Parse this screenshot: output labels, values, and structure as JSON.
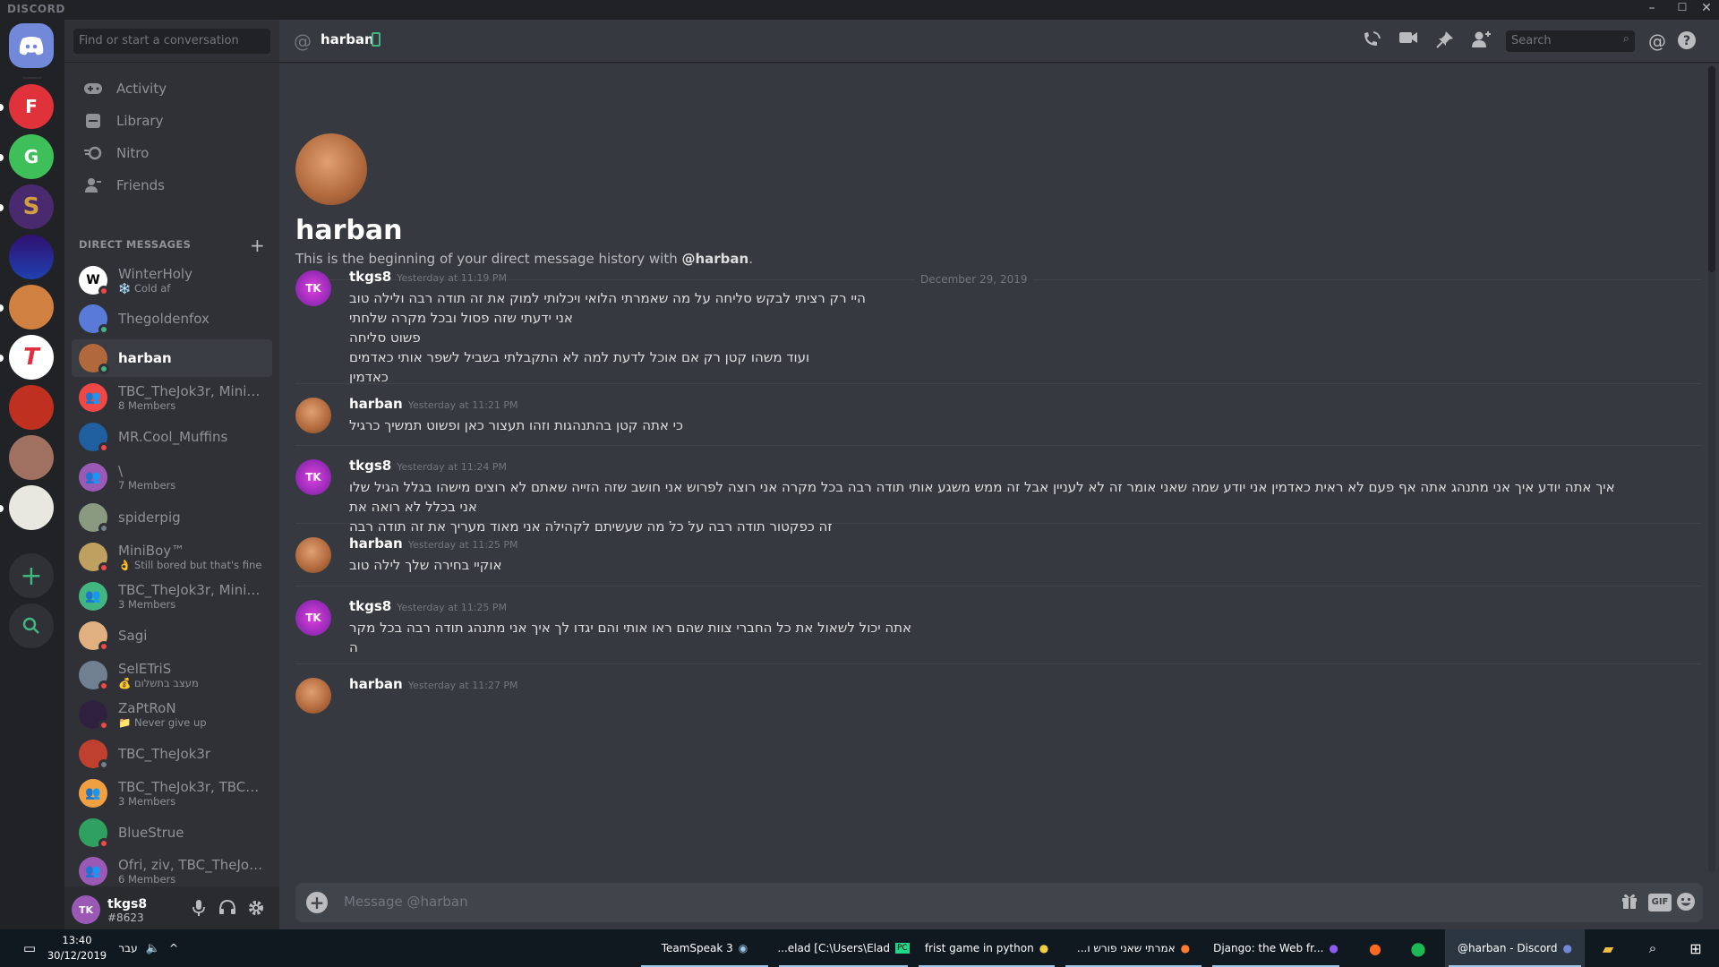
{
  "window": {
    "brand": "DISCORD",
    "controls": [
      "–",
      "☐",
      "✕"
    ]
  },
  "guilds": [
    {
      "name": "Home",
      "initial": "",
      "color": "#7289da"
    },
    {
      "name": "server-fedix",
      "initial": "F",
      "color": "#e0323a"
    },
    {
      "name": "server-green",
      "initial": "G",
      "color": "#3fbf5a"
    },
    {
      "name": "server-s",
      "initial": "S",
      "color": "#4a2a6e"
    },
    {
      "name": "server-blue",
      "initial": "",
      "color": "#2040b0"
    },
    {
      "name": "server-face",
      "initial": "",
      "color": "#d08040"
    },
    {
      "name": "server-t",
      "initial": "T",
      "color": "#e03040"
    },
    {
      "name": "server-red",
      "initial": "",
      "color": "#c03020"
    },
    {
      "name": "server-man",
      "initial": "",
      "color": "#a07060"
    },
    {
      "name": "server-dino",
      "initial": "",
      "color": "#e0e0e0"
    }
  ],
  "sidebar": {
    "search_placeholder": "Find or start a conversation",
    "nav": [
      {
        "label": "Activity",
        "icon": "activity-icon"
      },
      {
        "label": "Library",
        "icon": "library-icon"
      },
      {
        "label": "Nitro",
        "icon": "nitro-icon"
      },
      {
        "label": "Friends",
        "icon": "friends-icon"
      }
    ],
    "dm_header": "DIRECT MESSAGES",
    "dms": [
      {
        "name": "WinterHoly",
        "sub": "❄️ Cold af",
        "avatar_letter": "W",
        "color": "#ffffff",
        "status": "#f04747"
      },
      {
        "name": "Thegoldenfox",
        "sub": "",
        "avatar_letter": "",
        "color": "#5a7ad8",
        "status": "#43b581"
      },
      {
        "name": "harban",
        "sub": "",
        "avatar_letter": "",
        "color": "#b0683c",
        "status": "#43b581"
      },
      {
        "name": "TBC_TheJok3r, MiniB...",
        "sub": "8 Members",
        "avatar_letter": "👥",
        "color": "#f04747",
        "status": ""
      },
      {
        "name": "MR.Cool_Muffins",
        "sub": "",
        "avatar_letter": "",
        "color": "#2060a0",
        "status": "#f04747"
      },
      {
        "name": "\\",
        "sub": "7 Members",
        "avatar_letter": "👥",
        "color": "#9b59b6",
        "status": ""
      },
      {
        "name": "spiderpig",
        "sub": "",
        "avatar_letter": "",
        "color": "#8a9a80",
        "status": "#747f8d"
      },
      {
        "name": "MiniBoy™",
        "sub": "👌 Still bored but that's fine",
        "avatar_letter": "",
        "color": "#c0a060",
        "status": "#f04747"
      },
      {
        "name": "TBC_TheJok3r, MiniB...",
        "sub": "3 Members",
        "avatar_letter": "👥",
        "color": "#43b581",
        "status": ""
      },
      {
        "name": "Sagi",
        "sub": "",
        "avatar_letter": "",
        "color": "#e0b080",
        "status": "#f04747"
      },
      {
        "name": "SelETriS",
        "sub": "💰 מעצב בתשלום",
        "avatar_letter": "",
        "color": "#708090",
        "status": "#f04747"
      },
      {
        "name": "ZaPtRoN",
        "sub": "📁 Never give up",
        "avatar_letter": "",
        "color": "#302040",
        "status": "#f04747"
      },
      {
        "name": "TBC_TheJok3r",
        "sub": "",
        "avatar_letter": "",
        "color": "#c04030",
        "status": "#747f8d"
      },
      {
        "name": "TBC_TheJok3r, TBC_...",
        "sub": "3 Members",
        "avatar_letter": "👥",
        "color": "#f0a040",
        "status": ""
      },
      {
        "name": "BlueStrue",
        "sub": "",
        "avatar_letter": "",
        "color": "#30a060",
        "status": "#f04747"
      },
      {
        "name": "Ofri, ziv, TBC_TheJok...",
        "sub": "6 Members",
        "avatar_letter": "👥",
        "color": "#9b59b6",
        "status": ""
      }
    ],
    "user": {
      "name": "tkgs8",
      "tag": "#8623",
      "avatar_text": "TK"
    }
  },
  "header": {
    "title": "harban",
    "search_placeholder": "Search"
  },
  "intro": {
    "name": "harban",
    "desc_prefix": "This is the beginning of your direct message history with ",
    "desc_mention": "@harban",
    "desc_suffix": "."
  },
  "date_divider": "December 29, 2019",
  "messages": [
    {
      "author": "tkgs8",
      "ts": "Yesterday at 11:19 PM",
      "avatar": "TK",
      "color": "#c040c0",
      "lines": [
        "היי רק רציתי לבקש סליחה על מה שאמרתי הלואי ויכלותי למוק את זה תודה רבה ולילה טוב",
        "אני ידעתי שזה פסול ובכל מקרה שלחתי",
        "פשוט סליחה",
        "ועוד משהו קטן רק אם אוכל לדעת למה לא התקבלתי בשביל לשפר אותי כאדמים",
        "כאדמין"
      ]
    },
    {
      "author": "harban",
      "ts": "Yesterday at 11:21 PM",
      "avatar": "",
      "color": "#b0683c",
      "lines": [
        "כי אתה קטן בהתנהגות וזהו תעצור כאן ופשוט תמשיך כרגיל"
      ]
    },
    {
      "author": "tkgs8",
      "ts": "Yesterday at 11:24 PM",
      "avatar": "TK",
      "color": "#c040c0",
      "lines": [
        "איך אתה יודע איך אני מתנהג אתה אף פעם לא ראית כאדמין אני יודע שמה שאני אומר זה לא לעניין אבל זה ממש משגע אותי תודה רבה בכל מקרה אני רוצה לפרוש אני חושב שזה הזייה שאתם לא רוצים מישהו בגלל הגיל שלו אני בכלל לא רואה את",
        "זה כפקטור תודה רבה על כל מה שעשיתם לקהילה אני מאוד מעריך את זה תודה רבה"
      ]
    },
    {
      "author": "harban",
      "ts": "Yesterday at 11:25 PM",
      "avatar": "",
      "color": "#b0683c",
      "lines": [
        "אוקיי בחירה שלך לילה טוב"
      ]
    },
    {
      "author": "tkgs8",
      "ts": "Yesterday at 11:25 PM",
      "avatar": "TK",
      "color": "#c040c0",
      "lines": [
        "אתה יכול לשאול את כל החברי צוות שהם ראו אותי והם יגדו לך איך אני מתנהג תודה רבה בכל מקר",
        "ה"
      ]
    },
    {
      "author": "harban",
      "ts": "Yesterday at 11:27 PM",
      "avatar": "",
      "color": "#b0683c",
      "lines": []
    }
  ],
  "composer": {
    "placeholder": "Message @harban",
    "gif_label": "GIF"
  },
  "taskbar": {
    "time": "13:40",
    "date": "30/12/2019",
    "lang": "עבר",
    "apps": [
      {
        "label": "TeamSpeak 3"
      },
      {
        "label": "...elad [C:\\Users\\Elad"
      },
      {
        "label": "frist game in python"
      },
      {
        "label": "...אמרתי שאני פורש ו"
      },
      {
        "label": "Django: the Web fr..."
      },
      {
        "label": ""
      },
      {
        "label": ""
      },
      {
        "label": "@harban - Discord"
      }
    ]
  }
}
